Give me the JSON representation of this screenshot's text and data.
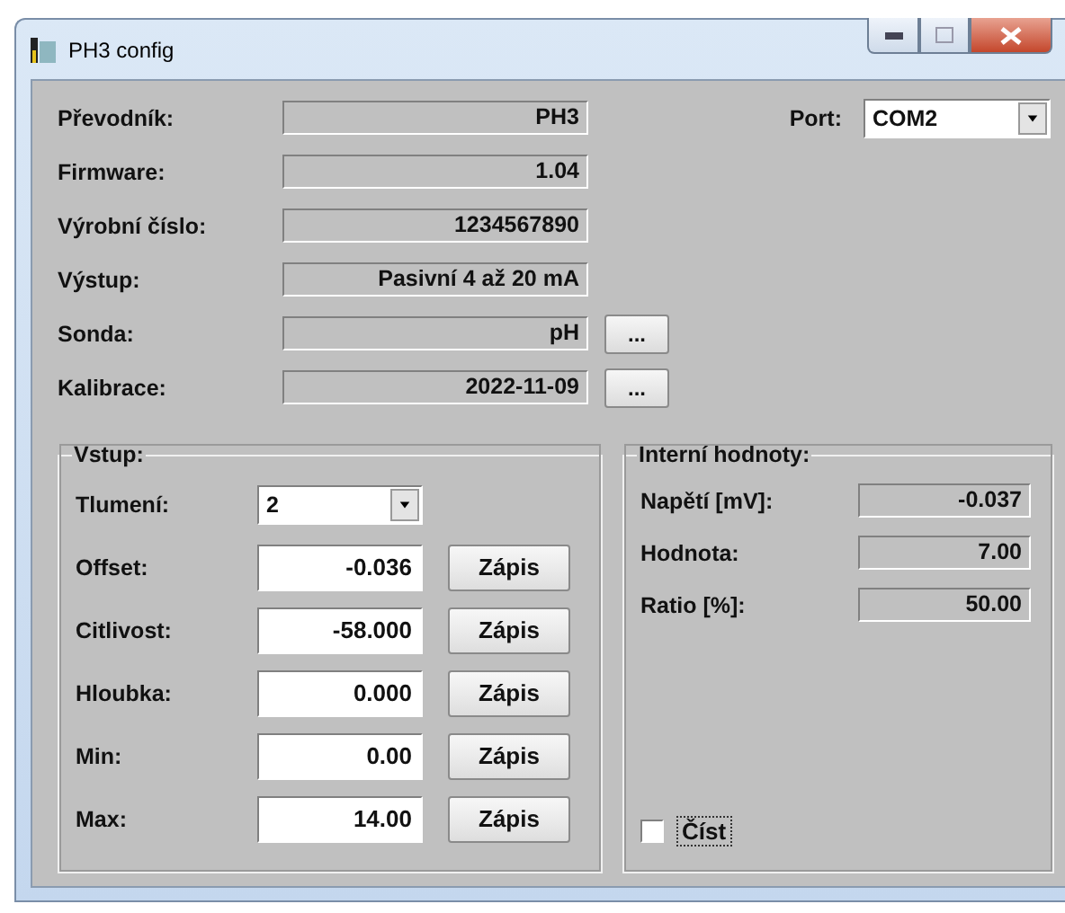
{
  "window": {
    "title": "PH3 config"
  },
  "info": [
    {
      "label": "Převodník:",
      "value": "PH3"
    },
    {
      "label": "Firmware:",
      "value": "1.04"
    },
    {
      "label": "Výrobní číslo:",
      "value": "1234567890"
    },
    {
      "label": "Výstup:",
      "value": "Pasivní 4 až 20 mA"
    },
    {
      "label": "Sonda:",
      "value": "pH",
      "button": "..."
    },
    {
      "label": "Kalibrace:",
      "value": "2022-11-09",
      "button": "..."
    }
  ],
  "port": {
    "label": "Port:",
    "value": "COM2"
  },
  "input_group": {
    "title": "Vstup:",
    "damping": {
      "label": "Tlumení:",
      "value": "2"
    },
    "rows": [
      {
        "label": "Offset:",
        "value": "-0.036",
        "button": "Zápis"
      },
      {
        "label": "Citlivost:",
        "value": "-58.000",
        "button": "Zápis"
      },
      {
        "label": "Hloubka:",
        "value": "0.000",
        "button": "Zápis"
      },
      {
        "label": "Min:",
        "value": "0.00",
        "button": "Zápis"
      },
      {
        "label": "Max:",
        "value": "14.00",
        "button": "Zápis"
      }
    ]
  },
  "internal_group": {
    "title": "Interní hodnoty:",
    "rows": [
      {
        "label": "Napětí [mV]:",
        "value": "-0.037"
      },
      {
        "label": "Hodnota:",
        "value": "7.00"
      },
      {
        "label": "Ratio [%]:",
        "value": "50.00"
      }
    ],
    "read_checkbox": {
      "label": "Číst",
      "checked": false
    }
  }
}
